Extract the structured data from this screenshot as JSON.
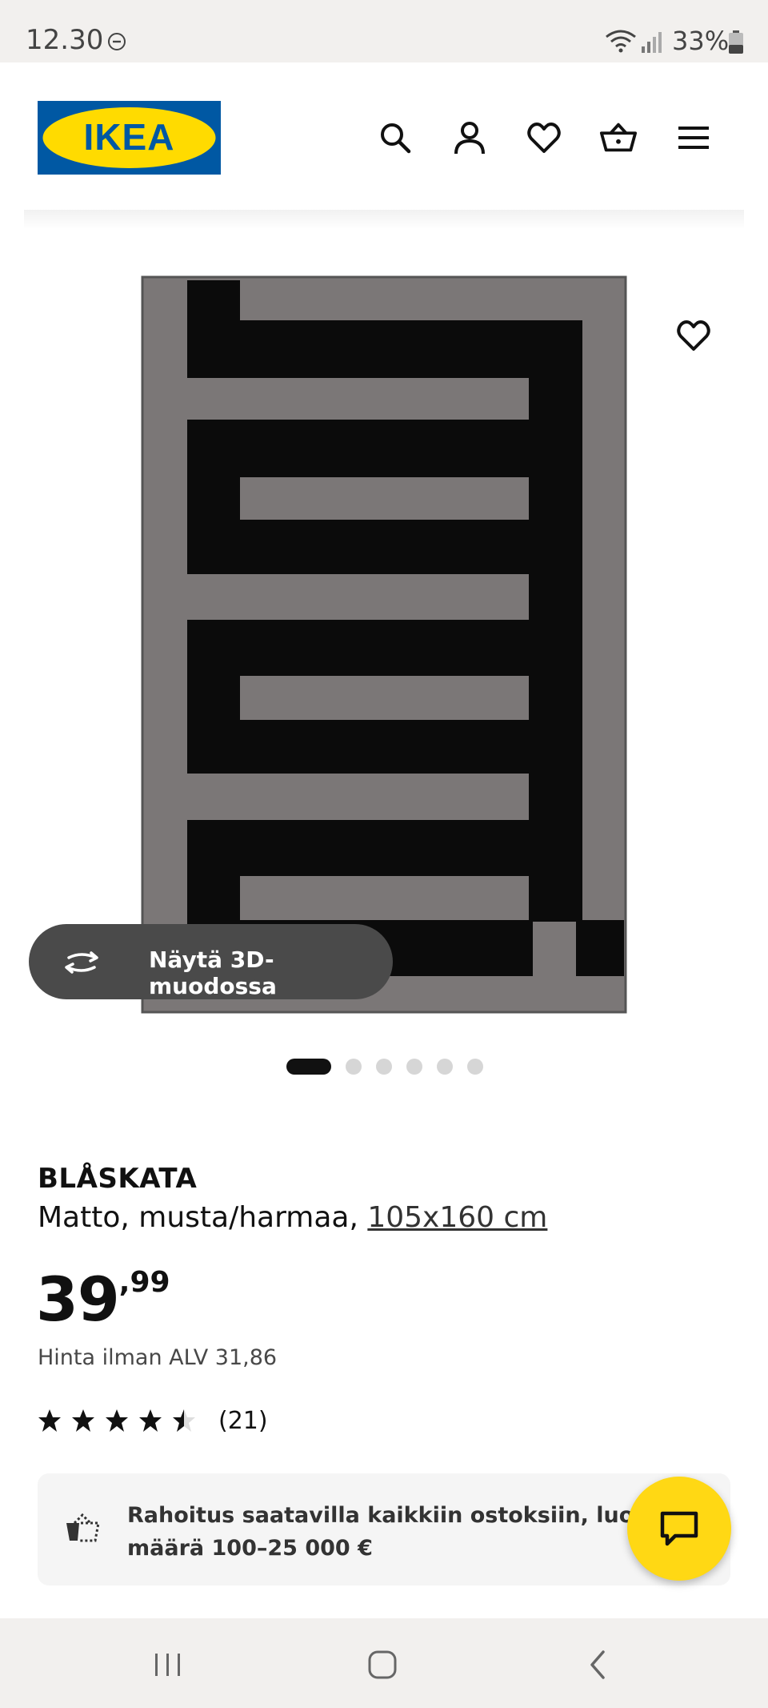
{
  "status_bar": {
    "time": "12.30",
    "battery": "33%",
    "icons": [
      "do-not-disturb-icon",
      "wifi-icon",
      "signal-icon",
      "battery-icon"
    ]
  },
  "header": {
    "logo_text": "IKEA",
    "icons": [
      "search-icon",
      "account-icon",
      "wishlist-icon",
      "cart-icon",
      "menu-icon"
    ]
  },
  "gallery": {
    "view_3d_label": "Näytä 3D-muodossa",
    "slide_count": 6,
    "active_slide": 1
  },
  "product": {
    "name": "BLÅSKATA",
    "description": "Matto, musta/harmaa,",
    "size": "105x160 cm",
    "price_int": "39",
    "price_dec": ",99",
    "price_vat": "Hinta ilman ALV 31,86",
    "rating": 4.5,
    "rating_count": "(21)"
  },
  "finance": {
    "text": "Rahoitus saatavilla kaikkiin ostoksiin, luoton määrä 100–25 000 €"
  },
  "colors": {
    "brand_blue": "#0058a3",
    "brand_yellow": "#ffdb00",
    "fab_yellow": "#ffd814",
    "rug_grey": "#7b7777",
    "rug_black": "#0b0b0b"
  }
}
